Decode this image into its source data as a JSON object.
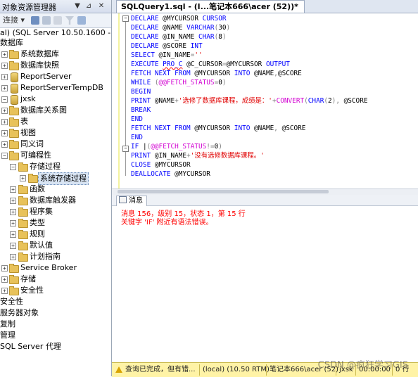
{
  "explorer": {
    "title": "对象资源管理器",
    "header_buttons": [
      "▼",
      "⊿",
      "✕"
    ],
    "toolbar": {
      "connect": "连接"
    },
    "tree": [
      {
        "label": "al) (SQL Server 10.50.1600 - 笔记本",
        "icon": "server-icon"
      },
      {
        "label": "数据库",
        "icon": "folder-icon"
      },
      {
        "label": "系统数据库",
        "icon": "folder-icon"
      },
      {
        "label": "数据库快照",
        "icon": "folder-icon"
      },
      {
        "label": "ReportServer",
        "icon": "database-icon"
      },
      {
        "label": "ReportServerTempDB",
        "icon": "database-icon"
      },
      {
        "label": "jxsk",
        "icon": "database-icon"
      },
      {
        "label": "数据库关系图",
        "icon": "folder-icon"
      },
      {
        "label": "表",
        "icon": "folder-icon"
      },
      {
        "label": "视图",
        "icon": "folder-icon"
      },
      {
        "label": "同义词",
        "icon": "folder-icon"
      },
      {
        "label": "可编程性",
        "icon": "folder-icon"
      },
      {
        "label": "存储过程",
        "icon": "folder-icon"
      },
      {
        "label": "系统存储过程",
        "icon": "folder-icon"
      },
      {
        "label": "函数",
        "icon": "folder-icon"
      },
      {
        "label": "数据库触发器",
        "icon": "folder-icon"
      },
      {
        "label": "程序集",
        "icon": "folder-icon"
      },
      {
        "label": "类型",
        "icon": "folder-icon"
      },
      {
        "label": "规则",
        "icon": "folder-icon"
      },
      {
        "label": "默认值",
        "icon": "folder-icon"
      },
      {
        "label": "计划指南",
        "icon": "folder-icon"
      },
      {
        "label": "Service Broker",
        "icon": "folder-icon"
      },
      {
        "label": "存储",
        "icon": "folder-icon"
      },
      {
        "label": "安全性",
        "icon": "folder-icon"
      },
      {
        "label": "安全性",
        "icon": "none"
      },
      {
        "label": "服务器对象",
        "icon": "none"
      },
      {
        "label": "复制",
        "icon": "none"
      },
      {
        "label": "管理",
        "icon": "none"
      },
      {
        "label": "SQL Server 代理",
        "icon": "none"
      }
    ]
  },
  "editor": {
    "tab_title": "SQLQuery1.sql - (l...笔记本666\\acer (52))*",
    "lines": [
      "DECLARE @MYCURSOR CURSOR",
      "DECLARE @NAME VARCHAR(30)",
      "DECLARE @IN_NAME CHAR(8)",
      "DECLARE @SCORE INT",
      "SELECT @IN_NAME=''",
      "EXECUTE PRO_C @C_CURSOR=@MYCURSOR OUTPUT",
      "FETCH NEXT FROM @MYCURSOR INTO @NAME,@SCORE",
      "WHILE (@@FETCH_STATUS=0)",
      "BEGIN",
      "PRINT @NAME+'选修了数据库课程，成绩是：'+CONVERT(CHAR(2), @SCORE",
      "BREAK",
      "END",
      "FETCH NEXT FROM @MYCURSOR INTO @NAME, @SCORE",
      "END",
      "IF (@@FETCH_STATUS!=0)",
      "PRINT @IN_NAME+'没有选修数据库课程。'",
      "CLOSE @MYCURSOR",
      "DEALLOCATE @MYCURSOR"
    ]
  },
  "results": {
    "tab_label": "消息",
    "messages": [
      "消息 156，级别 15，状态 1，第 15 行",
      "关键字 'IF' 附近有语法错误。"
    ]
  },
  "status_bar": {
    "query_status": "查询已完成，但有错...",
    "server": "(local) (10.50 RTM)",
    "user": "笔记本666\\acer (52)",
    "database": "jxsk",
    "elapsed": "00:00:00",
    "rows": "0 行"
  },
  "watermark": "CSDN @疯狂学习GIS",
  "colors": {
    "keyword": "#0000ff",
    "string": "#e00000",
    "operator": "#808080",
    "function": "#d200d2",
    "error_text": "#ff0000",
    "status_bar_bg": "#fff3a6"
  }
}
